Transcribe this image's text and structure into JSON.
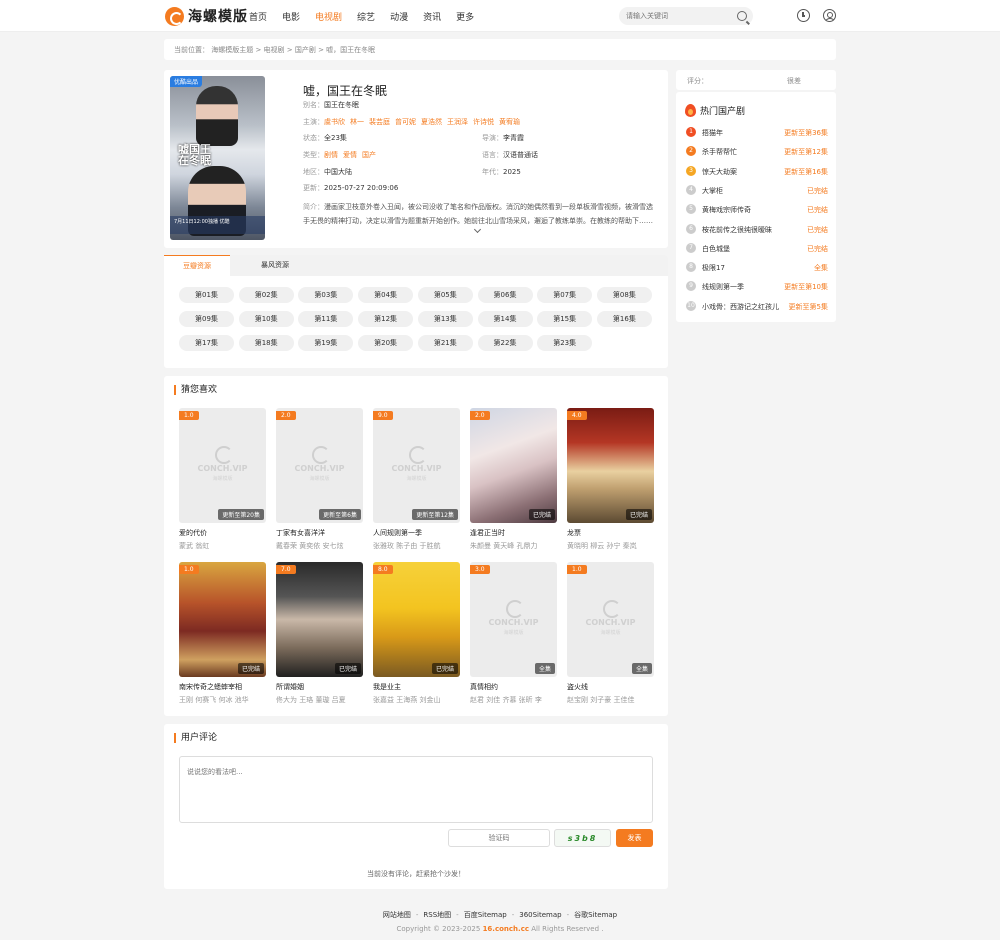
{
  "site": {
    "logo_text": "海螺模版"
  },
  "nav": [
    "首页",
    "电影",
    "电视剧",
    "综艺",
    "动漫",
    "资讯",
    "更多"
  ],
  "nav_active": "电视剧",
  "search": {
    "placeholder": "请输入关键词"
  },
  "breadcrumb": "当前位置： 海螺模版主题 > 电视剧 > 国产剧 > 嘘，国王在冬眠",
  "detail": {
    "poster_tag": "优酷出品",
    "poster_title": "嘘国王在冬眠",
    "poster_band": "7月11日12:00独播 优酷",
    "title": "嘘，国王在冬眠",
    "alias_label": "别名：",
    "alias": "国王在冬眠",
    "cast_label": "主演：",
    "cast": [
      "虞书欣",
      "林一",
      "裴芸庭",
      "曾可妮",
      "夏浩然",
      "王润泽",
      "许诗悦",
      "黄宥瑜"
    ],
    "status_label": "状态：",
    "status": "全23集",
    "director_label": "导演：",
    "director": "李青霞",
    "genre_label": "类型：",
    "genres": [
      "剧情",
      "爱情",
      "国产"
    ],
    "lang_label": "语言：",
    "lang": "汉语普通话",
    "region_label": "地区：",
    "region": "中国大陆",
    "year_label": "年代：",
    "year": "2025",
    "updated_label": "更新：",
    "updated": "2025-07-27 20:09:06",
    "intro_label": "简介：",
    "intro": "漫画家卫枝意外卷入丑闻，被公司没收了笔名和作品版权。消沉的她偶然看到一段单板滑雪视频，被滑雪选手无畏的精神打动，决定以滑雪为题重新开始创作。她前往北山雪场采风，邂逅了教练单崇。在教练的帮助下……"
  },
  "episodes": {
    "tabs": [
      "豆瓣资源",
      "暴风资源"
    ],
    "active_tab": "豆瓣资源",
    "list": [
      "第01集",
      "第02集",
      "第03集",
      "第04集",
      "第05集",
      "第06集",
      "第07集",
      "第08集",
      "第09集",
      "第10集",
      "第11集",
      "第12集",
      "第13集",
      "第14集",
      "第15集",
      "第16集",
      "第17集",
      "第18集",
      "第19集",
      "第20集",
      "第21集",
      "第22集",
      "第23集"
    ]
  },
  "recommend": {
    "title": "猜您喜欢",
    "watermark": "CONCH.VIP",
    "watermark_sub": "海螺模版",
    "items": [
      {
        "name": "爱的代价",
        "actors": "蒙武 翁虹",
        "score": "1.0",
        "status": "更新至第20集",
        "poster": "placeholder"
      },
      {
        "name": "丁家有女喜洋洋",
        "actors": "戴春荣 黄奕依 安七炫",
        "score": "2.0",
        "status": "更新至第6集",
        "poster": "placeholder"
      },
      {
        "name": "人间规则第一季",
        "actors": "张雅玫 陈子由 于胜航",
        "score": "9.0",
        "status": "更新至第12集",
        "poster": "placeholder"
      },
      {
        "name": "逢君正当时",
        "actors": "朱颜曼 黄天峰 孔鼎力",
        "score": "2.0",
        "status": "已完结",
        "poster": "couple"
      },
      {
        "name": "龙票",
        "actors": "黄晓明 柳云 孙宁 秦岚",
        "score": "4.0",
        "status": "已完结",
        "poster": "dragon"
      },
      {
        "name": "南宋传奇之蟋蟀宰相",
        "actors": "王刚 何赛飞 何冰 池华",
        "score": "1.0",
        "status": "已完结",
        "poster": "song"
      },
      {
        "name": "所谓婚姻",
        "actors": "佟大为 王珞 董璇 吕夏",
        "score": "7.0",
        "status": "已完结",
        "poster": "marriage"
      },
      {
        "name": "我是业主",
        "actors": "张嘉益 王海燕 刘金山",
        "score": "8.0",
        "status": "已完结",
        "poster": "owner"
      },
      {
        "name": "真情相约",
        "actors": "赵君 刘佳 齐慕 张昕 李",
        "score": "3.0",
        "status": "全集",
        "poster": "placeholder"
      },
      {
        "name": "盗火线",
        "actors": "赵宝刚 刘子豪 王佳佳",
        "score": "1.0",
        "status": "全集",
        "poster": "placeholder"
      }
    ]
  },
  "comment": {
    "title": "用户评论",
    "placeholder": "说说您的看法吧...",
    "verify_placeholder": "验证码",
    "captcha": "s3b8",
    "submit": "发表",
    "empty": "当前没有评论，赶紧抢个沙发！"
  },
  "sidebar": {
    "rating_label": "评分：",
    "rating_value": "很差",
    "hot_title": "热门国产剧",
    "hot": [
      {
        "name": "捂猫年",
        "status": "更新至第36集"
      },
      {
        "name": "杀手帮帮忙",
        "status": "更新至第12集"
      },
      {
        "name": "惊天大劫案",
        "status": "更新至第16集"
      },
      {
        "name": "大掌柜",
        "status": "已完结"
      },
      {
        "name": "黄梅戏宗师传奇",
        "status": "已完结"
      },
      {
        "name": "桉花前传之很纯很暧昧",
        "status": "已完结"
      },
      {
        "name": "白色城堡",
        "status": "已完结"
      },
      {
        "name": "极限17",
        "status": "全集"
      },
      {
        "name": "线规则第一季",
        "status": "更新至第10集"
      },
      {
        "name": "小戏骨：西游记之红孩儿",
        "status": "更新至第5集"
      }
    ]
  },
  "footer": {
    "links": [
      "网站地图",
      "RSS地图",
      "百度Sitemap",
      "360Sitemap",
      "谷歌Sitemap"
    ],
    "copy_prefix": "Copyright © 2023-2025",
    "copy_domain": "16.conch.cc",
    "copy_suffix": "All Rights Reserved ."
  },
  "colors": {
    "accent": "#f47b20",
    "hot1": "#f04e23",
    "hot3": "#f5a623"
  }
}
